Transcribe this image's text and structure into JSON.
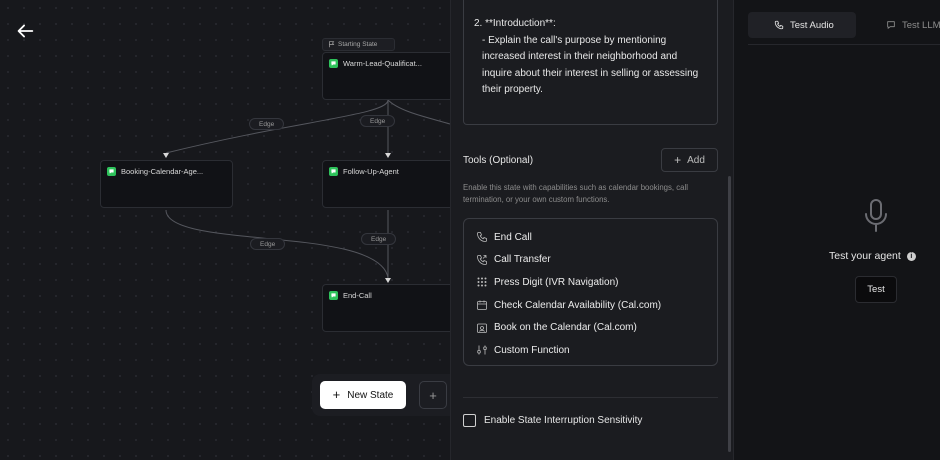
{
  "canvas": {
    "start_tag": "Starting State",
    "nodes": [
      {
        "label": "Warm-Lead-Qualificat..."
      },
      {
        "label": "Booking-Calendar-Age..."
      },
      {
        "label": "Follow-Up-Agent"
      },
      {
        "label": "End-Call"
      }
    ],
    "edges": [
      "Edge",
      "Edge",
      "Edge",
      "Edge"
    ],
    "new_state_label": "New State",
    "plus_label": "+",
    "icons": {
      "back": "arrow-left-icon",
      "node": "chat-bubble-icon",
      "flag": "flag-icon"
    }
  },
  "editor": {
    "prompt_heading": "2. **Introduction**:",
    "prompt_body": "- Explain the call's purpose by mentioning increased interest in their neighborhood and inquire about their interest in selling or assessing their property.",
    "tools_title": "Tools (Optional)",
    "add_label": "Add",
    "tools_desc": "Enable this state with capabilities such as calendar bookings, call termination, or your own custom functions.",
    "tools": [
      {
        "label": "End Call",
        "icon": "phone-icon"
      },
      {
        "label": "Call Transfer",
        "icon": "phone-forward-icon"
      },
      {
        "label": "Press Digit (IVR Navigation)",
        "icon": "keypad-icon"
      },
      {
        "label": "Check Calendar Availability (Cal.com)",
        "icon": "calendar-icon"
      },
      {
        "label": "Book on the Calendar (Cal.com)",
        "icon": "calendar-book-icon"
      },
      {
        "label": "Custom Function",
        "icon": "sliders-icon"
      }
    ],
    "interruption_label": "Enable State Interruption Sensitivity",
    "interruption_checked": false
  },
  "test_panel": {
    "tabs": [
      {
        "label": "Test Audio",
        "icon": "phone-icon",
        "active": true
      },
      {
        "label": "Test LLM",
        "icon": "chat-icon",
        "active": false
      }
    ],
    "heading": "Test your agent",
    "info_mark": "i",
    "test_button": "Test",
    "mic_icon": "microphone-icon"
  },
  "colors": {
    "accent_green": "#2ec25b",
    "background": "#131417",
    "panel": "#1b1c20"
  }
}
